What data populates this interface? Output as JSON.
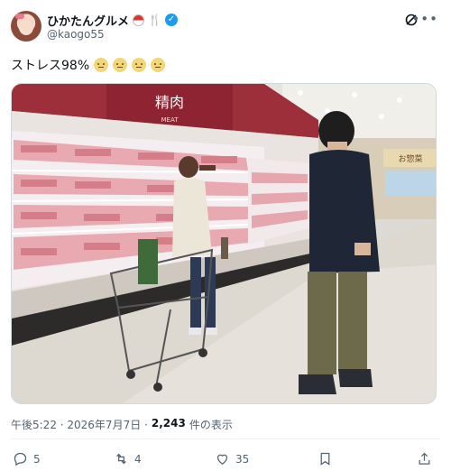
{
  "post": {
    "display_name": "ひかたんグルメ",
    "handle": "@kaogo55",
    "text": "ストレス98%",
    "photo": {
      "signage_main": "精肉",
      "signage_sub": "MEAT",
      "signage_right": "お惣菜"
    },
    "timestamp": "午後5:22 · 2026年7月7日 ·",
    "views_count": "2,243",
    "views_label": "件の表示"
  },
  "actions": {
    "replies": "5",
    "reposts": "4",
    "likes": "35"
  },
  "icons": {
    "verified": "verified-badge-icon",
    "grok": "grok-icon",
    "more": "more-icon",
    "reply": "reply-icon",
    "repost": "repost-icon",
    "like": "heart-icon",
    "bookmark": "bookmark-icon",
    "share": "share-icon"
  },
  "colors": {
    "accent": "#1d9bf0",
    "muted_text": "#536471"
  }
}
